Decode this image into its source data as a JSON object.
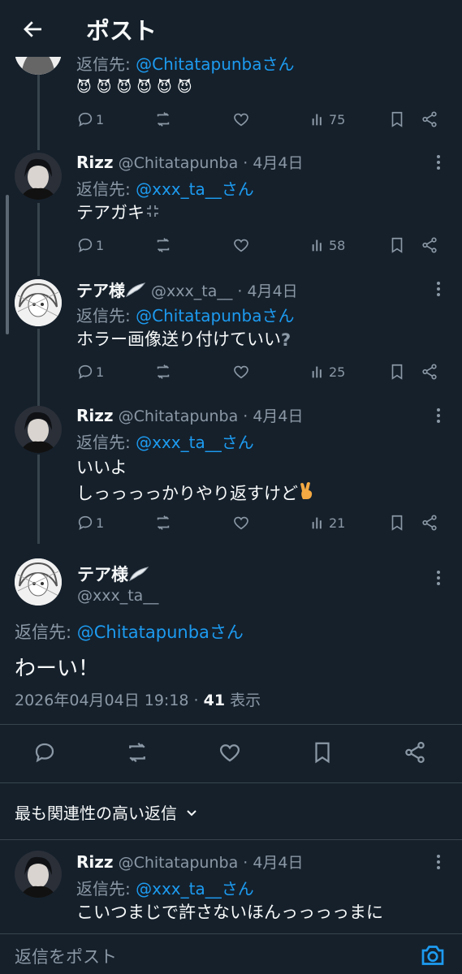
{
  "header": {
    "title": "ポスト"
  },
  "top_tweet": {
    "reply_prefix": "返信先: ",
    "reply_link": "@Chitatapunbaさん",
    "body": "😈😈😈😈😈😈",
    "replies": "1",
    "views": "75"
  },
  "tweets": [
    {
      "name": "Rizz",
      "handle": "@Chitatapunba · 4月4日",
      "reply_prefix": "返信先: ",
      "reply_link": "@xxx_ta__さん",
      "body": "テアガキ",
      "replies": "1",
      "views": "58"
    },
    {
      "name": "テア様",
      "handle": "@xxx_ta__ · 4月4日",
      "reply_prefix": "返信先: ",
      "reply_link": "@Chitatapunbaさん",
      "body": "ホラー画像送り付けていい",
      "replies": "1",
      "views": "25"
    },
    {
      "name": "Rizz",
      "handle": "@Chitatapunba · 4月4日",
      "reply_prefix": "返信先: ",
      "reply_link": "@xxx_ta__さん",
      "body_line1": "いいよ",
      "body_line2": "しっっっっかりやり返すけど",
      "replies": "1",
      "views": "21"
    }
  ],
  "focus": {
    "name": "テア様",
    "handle": "@xxx_ta__",
    "reply_prefix": "返信先: ",
    "reply_link": "@Chitatapunbaさん",
    "body": "わーい！",
    "timestamp": "2026年04月04日 19:18 · ",
    "views_count": "41",
    "views_label": " 表示"
  },
  "sort_label": "最も関連性の高い返信",
  "reply_tweet": {
    "name": "Rizz",
    "handle": "@Chitatapunba · 4月4日",
    "reply_prefix": "返信先: ",
    "reply_link": "@xxx_ta__さん",
    "body": "こいつまじで許さないほんっっっっまに"
  },
  "composer": {
    "placeholder": "返信をポスト"
  },
  "colors": {
    "background": "#15202b",
    "accent": "#1d9bf0",
    "muted": "#8b98a5",
    "text": "#f7f9f9"
  }
}
